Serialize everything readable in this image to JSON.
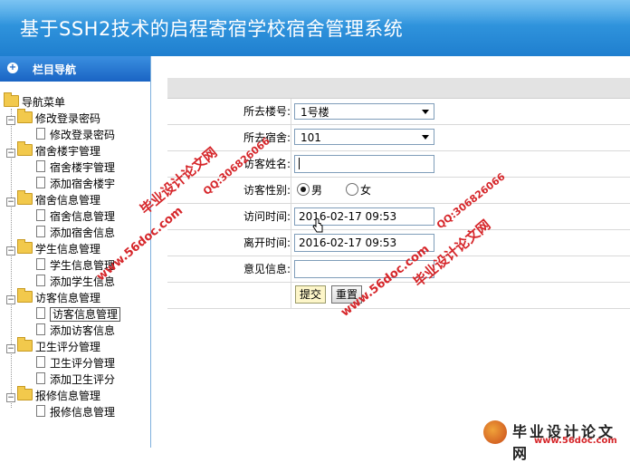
{
  "app_title": "基于SSH2技术的启程寄宿学校宿舍管理系统",
  "sidebar": {
    "header": "栏目导航",
    "root": "导航菜单",
    "groups": [
      {
        "label": "修改登录密码",
        "items": [
          "修改登录密码"
        ]
      },
      {
        "label": "宿舍楼宇管理",
        "items": [
          "宿舍楼宇管理",
          "添加宿舍楼宇"
        ]
      },
      {
        "label": "宿舍信息管理",
        "items": [
          "宿舍信息管理",
          "添加宿舍信息"
        ]
      },
      {
        "label": "学生信息管理",
        "items": [
          "学生信息管理",
          "添加学生信息"
        ]
      },
      {
        "label": "访客信息管理",
        "items": [
          "访客信息管理",
          "添加访客信息"
        ]
      },
      {
        "label": "卫生评分管理",
        "items": [
          "卫生评分管理",
          "添加卫生评分"
        ]
      },
      {
        "label": "报修信息管理",
        "items": [
          "报修信息管理"
        ]
      }
    ],
    "selected": "访客信息管理"
  },
  "form": {
    "building_label": "所去楼号:",
    "building_value": "1号楼",
    "room_label": "所去宿舍:",
    "room_value": "101",
    "name_label": "访客姓名:",
    "name_value": "",
    "gender_label": "访客性别:",
    "gender_male": "男",
    "gender_female": "女",
    "gender_selected": "男",
    "visit_time_label": "访问时间:",
    "visit_time_value": "2016-02-17 09:53",
    "leave_time_label": "离开时间:",
    "leave_time_value": "2016-02-17 09:53",
    "opinion_label": "意见信息:",
    "opinion_value": "",
    "submit_label": "提交",
    "reset_label": "重置"
  },
  "watermarks": {
    "site_name": "毕业设计论文网",
    "url": "www.56doc.com",
    "qq": "QQ:306826066",
    "corner_title": "毕业设计论文网",
    "corner_url": "www.56doc.com"
  }
}
